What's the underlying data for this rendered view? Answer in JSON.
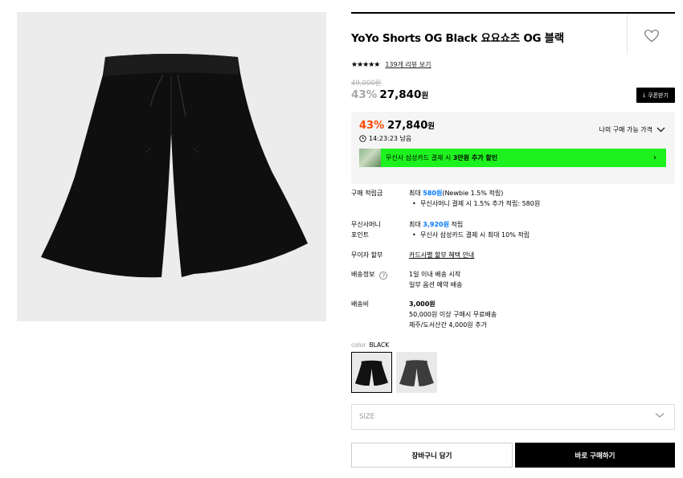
{
  "product": {
    "title": "YoYo Shorts OG Black 요요쇼츠 OG 블랙",
    "stars": "★★★★★",
    "review_link": "139개 리뷰 보기",
    "original_price": "49,000원",
    "discount_pct": "43%",
    "price": "27,840",
    "currency": "원",
    "coupon_label": "쿠폰받기"
  },
  "price_box": {
    "discount_pct": "43%",
    "price": "27,840",
    "currency": "원",
    "timer": "14:23:23 남음",
    "my_price_label": "나의 구매 가능 가격",
    "promo_prefix": "무신사 삼성카드 결제 시 ",
    "promo_bold": "3만원 추가 할인"
  },
  "details": {
    "points_label": "구매 적립금",
    "points_prefix": "최대 ",
    "points_value": "580원",
    "points_suffix": "(Newbie 1.5% 적립)",
    "points_bullet": "무신사머니 결제 시 1.5% 추가 적립: 580원",
    "money_label_1": "무신사머니",
    "money_label_2": "포인트",
    "money_prefix": "최대 ",
    "money_value": "3,920원",
    "money_suffix": " 적립",
    "money_bullet": "무신사 삼성카드 결제 시 최대 10% 적립",
    "installment_label": "무이자 할부",
    "installment_link": "카드사별 할부 혜택 안내",
    "shipping_info_label": "배송정보",
    "shipping_info_help": "?",
    "shipping_info_1": "1일 이내 배송 시작",
    "shipping_info_2": "일부 옵션 예약 배송",
    "shipping_fee_label": "배송비",
    "shipping_fee": "3,000원",
    "shipping_free": "50,000원 이상 구매시 무료배송",
    "shipping_island": "제주/도서산간 4,000원 추가"
  },
  "options": {
    "color_key": "color",
    "color_value": "BLACK",
    "size_placeholder": "SIZE"
  },
  "actions": {
    "cart_label": "장바구니 담기",
    "buy_label": "바로 구매하기"
  },
  "colors": {
    "accent_discount": "#ff4800",
    "link_blue": "#0078ff",
    "promo_green": "#1ef21e"
  }
}
